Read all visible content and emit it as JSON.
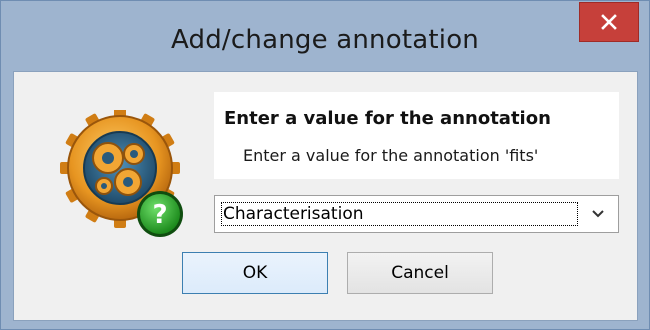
{
  "window": {
    "title": "Add/change annotation",
    "close_icon": "close-icon"
  },
  "dialog": {
    "icon": "gears-question-icon",
    "heading": "Enter a value for the annotation",
    "prompt": "Enter a value for the annotation 'fits'"
  },
  "combo": {
    "selected_value": "Characterisation",
    "arrow_icon": "chevron-down-icon"
  },
  "buttons": {
    "ok_label": "OK",
    "cancel_label": "Cancel"
  },
  "colors": {
    "frame": "#9eb4cf",
    "close_button": "#c6403a",
    "client_background": "#f0f0f0",
    "ok_border": "#3c7fb1"
  }
}
